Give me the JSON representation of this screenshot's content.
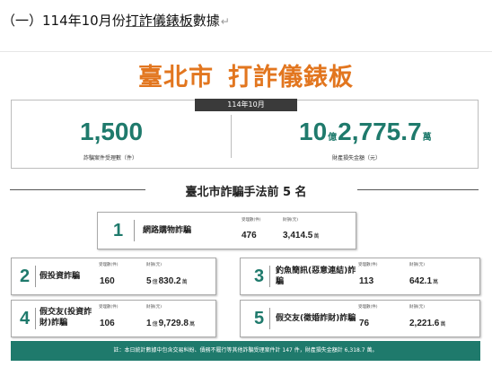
{
  "heading": {
    "prefix": "（一）114年10月份",
    "underlined": "打詐儀錶板",
    "suffix": "數據",
    "return_mark": "↵"
  },
  "title": {
    "left": "臺北市",
    "right": "打詐儀錶板"
  },
  "month_tag": "114年10月",
  "stats": {
    "cases": {
      "value": "1,500",
      "caption": "詐騙案件受理數（件）"
    },
    "loss": {
      "num1": "10",
      "unit1": "億",
      "num2": "2,775.7",
      "unit2": "萬",
      "caption": "財產損失金額（元）"
    }
  },
  "section_title": "臺北市詐騙手法前 5 名",
  "col_headers": {
    "cases": "受理數(件)",
    "loss": "財損(元)"
  },
  "top5": [
    {
      "rank": "1",
      "method": "網路購物詐騙",
      "cases": "476",
      "loss_a": "3,414.5",
      "unit_a": "萬",
      "loss_b": "",
      "unit_b": ""
    },
    {
      "rank": "2",
      "method": "假投資詐騙",
      "cases": "160",
      "loss_a": "5",
      "unit_a": "億",
      "loss_b": "830.2",
      "unit_b": "萬"
    },
    {
      "rank": "3",
      "method": "釣魚簡訊(惡意連結)詐騙",
      "cases": "113",
      "loss_a": "642.1",
      "unit_a": "萬",
      "loss_b": "",
      "unit_b": ""
    },
    {
      "rank": "4",
      "method": "假交友(投資詐財)詐騙",
      "cases": "106",
      "loss_a": "1",
      "unit_a": "億",
      "loss_b": "9,729.8",
      "unit_b": "萬"
    },
    {
      "rank": "5",
      "method": "假交友(徵婚詐財)詐騙",
      "cases": "76",
      "loss_a": "2,221.6",
      "unit_a": "萬",
      "loss_b": "",
      "unit_b": ""
    }
  ],
  "footer": "註：本日統計數據中包含交易糾紛、債務不履行等其他詐騙受理案件計 147 件，財產損失金額計 6,318.7 萬。",
  "colors": {
    "accent_orange": "#e2761f",
    "brand_green": "#1f7a6c",
    "tag_dark": "#3a3a3a"
  }
}
